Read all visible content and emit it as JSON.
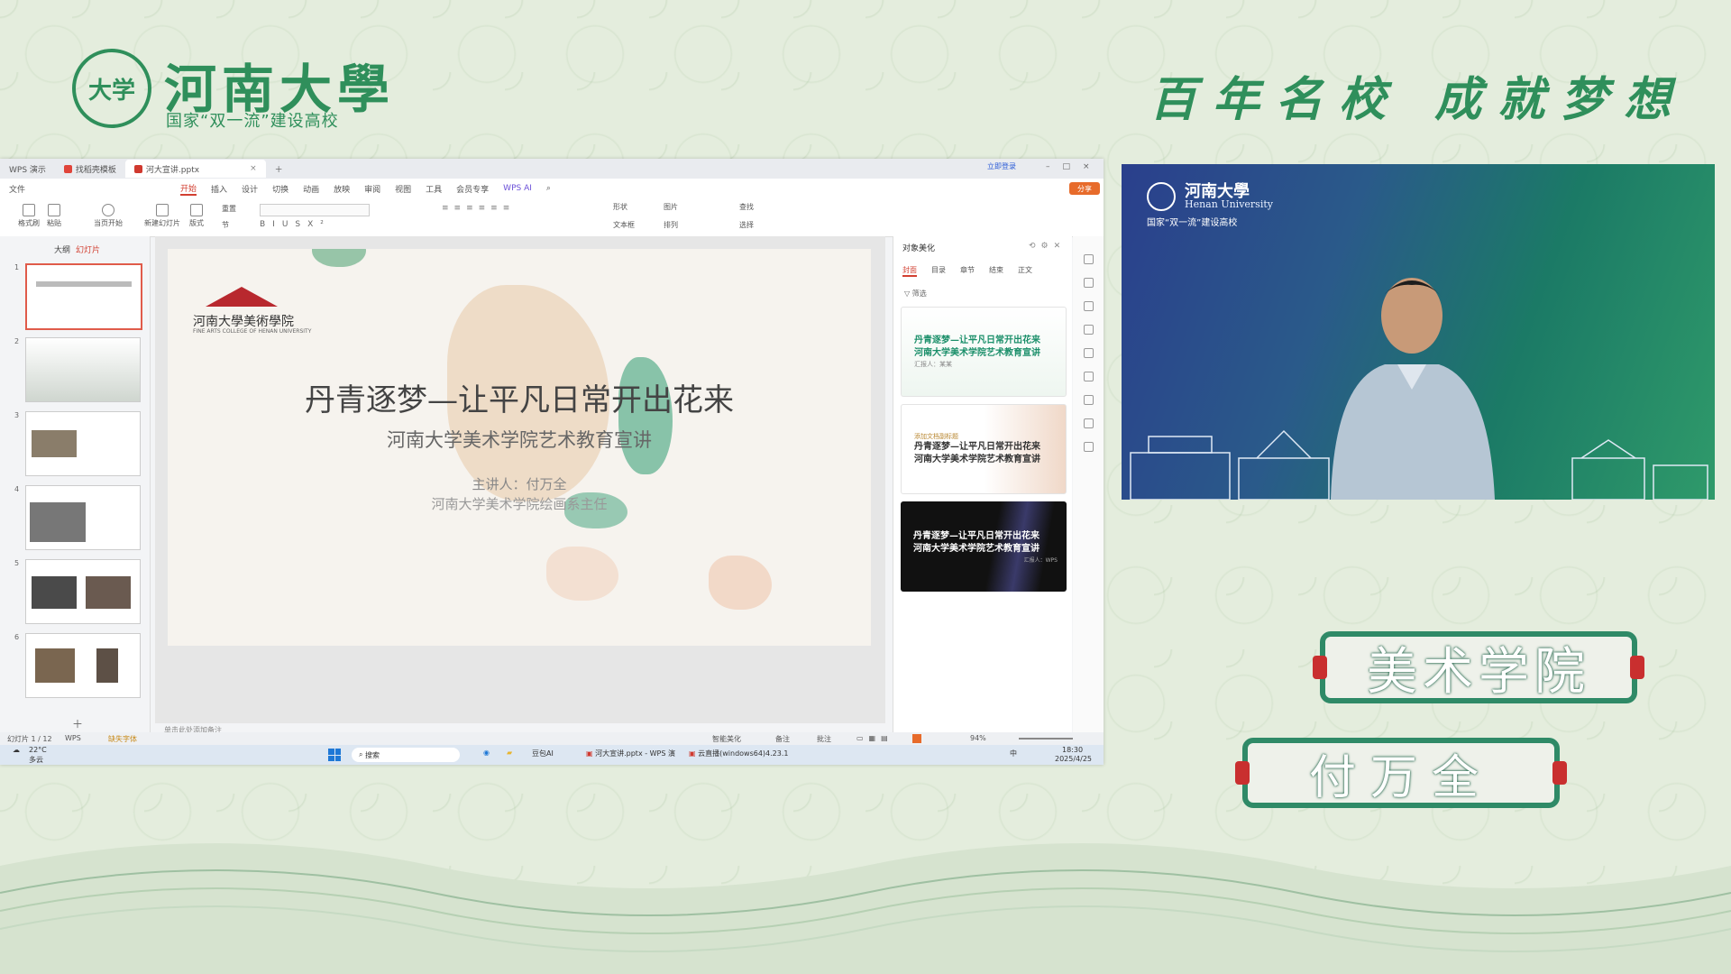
{
  "header": {
    "badge_text": "大学",
    "university_name": "河南大學",
    "university_sub": "国家“双一流”建设高校",
    "slogan": "百年名校 成就梦想"
  },
  "wps": {
    "tabs": [
      {
        "label": "WPS 演示"
      },
      {
        "label": "找稻壳模板"
      },
      {
        "label": "河大宣讲.pptx"
      }
    ],
    "login_label": "立即登录",
    "share_label": "分享",
    "menus": [
      "文件",
      "开始",
      "插入",
      "设计",
      "切换",
      "动画",
      "放映",
      "审阅",
      "视图",
      "工具",
      "会员专享",
      "WPS AI"
    ],
    "ribbon": {
      "format_painter": "格式刷",
      "paste": "粘贴",
      "play": "当页开始",
      "new_slide": "新建幻灯片",
      "layout": "版式",
      "reset": "重置",
      "section": "节",
      "shape": "形状",
      "picture": "图片",
      "textbox": "文本框",
      "arrange": "排列",
      "find": "查找",
      "select": "选择"
    },
    "thumb_tabs": {
      "outline": "大纲",
      "slides": "幻灯片"
    },
    "slide_numbers": [
      "1",
      "2",
      "3",
      "4",
      "5",
      "6"
    ],
    "slide": {
      "logo_text": "河南大學美術學院",
      "logo_en": "FINE ARTS COLLEGE OF HENAN UNIVERSITY",
      "title": "丹青逐梦—让平凡日常开出花来",
      "subtitle": "河南大学美术学院艺术教育宣讲",
      "speaker": "主讲人：付万全",
      "role": "河南大学美术学院绘画系主任"
    },
    "note_hint": "单击此处添加备注",
    "right_panel": {
      "title": "对象美化",
      "tabs": [
        "封面",
        "目录",
        "章节",
        "结束",
        "正文"
      ],
      "filter": "筛选",
      "templates": [
        {
          "line1": "丹青逐梦—让平凡日常开出花来",
          "line2": "河南大学美术学院艺术教育宣讲",
          "meta": "汇报人：某某"
        },
        {
          "line1": "丹青逐梦—让平凡日常开出花来",
          "line2": "河南大学美术学院艺术教育宣讲",
          "meta": "添加文档副标题"
        },
        {
          "line1": "丹青逐梦—让平凡日常开出花来",
          "line2": "河南大学美术学院艺术教育宣讲",
          "meta": "汇报人：WPS"
        }
      ]
    },
    "status": {
      "slide_count": "幻灯片 1 / 12",
      "theme": "WPS",
      "font_missing": "缺失字体",
      "smart_beautify": "智能美化",
      "notes": "备注",
      "comments": "批注",
      "zoom": "94%"
    }
  },
  "taskbar": {
    "weather_temp": "22°C",
    "weather_desc": "多云",
    "search": "搜索",
    "app_douban": "豆包AI",
    "app_wps": "河大宣讲.pptx - WPS 演",
    "app_live": "云直播(windows64)4.23.1",
    "ime": "中",
    "time": "18:30",
    "date": "2025/4/25"
  },
  "video": {
    "name": "河南大學",
    "en": "Henan University",
    "sub": "国家“双一流”建设高校"
  },
  "plates": {
    "college": "美术学院",
    "speaker": "付万全"
  },
  "colors": {
    "brand_green": "#2f8f5b",
    "wps_red": "#d23f31",
    "plate_border": "#2f8a67"
  }
}
